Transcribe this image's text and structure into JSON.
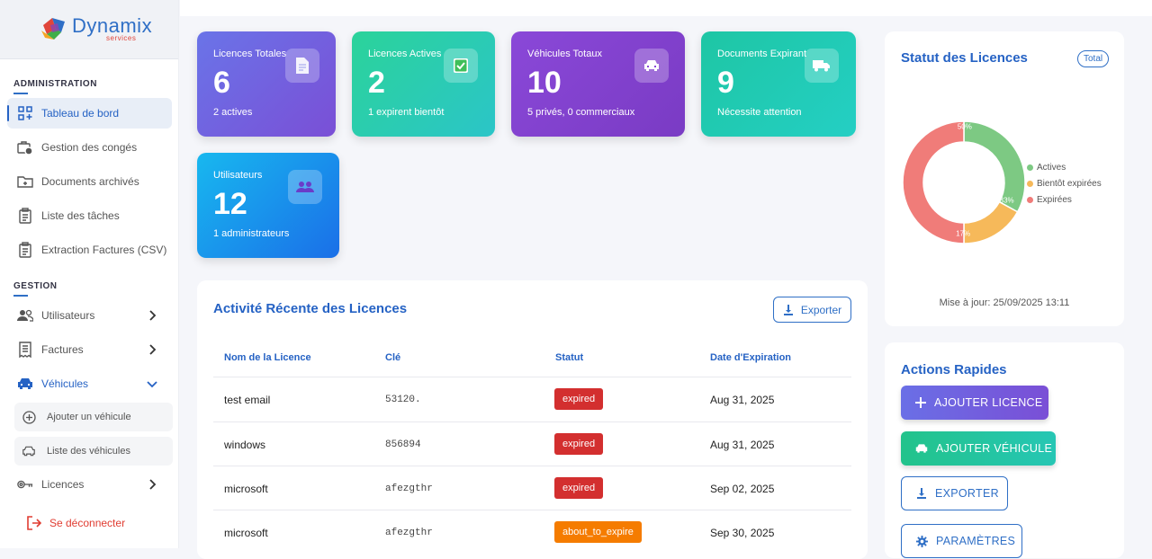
{
  "app": {
    "logo_name": "Dynamix",
    "logo_sub": "services"
  },
  "sidebar": {
    "section_admin": "ADMINISTRATION",
    "section_gestion": "GESTION",
    "items": [
      {
        "label": "Tableau de bord",
        "icon": "dashboard-icon"
      },
      {
        "label": "Gestion des congés",
        "icon": "briefcase-clock-icon"
      },
      {
        "label": "Documents archivés",
        "icon": "folder-icon"
      },
      {
        "label": "Liste des tâches",
        "icon": "clipboard-icon"
      },
      {
        "label": "Extraction Factures (CSV)",
        "icon": "clipboard-icon"
      },
      {
        "label": "Utilisateurs",
        "icon": "users-icon"
      },
      {
        "label": "Factures",
        "icon": "receipt-icon"
      },
      {
        "label": "Véhicules",
        "icon": "car-icon"
      },
      {
        "label": "Licences",
        "icon": "key-icon"
      }
    ],
    "subitems": [
      {
        "label": "Ajouter un véhicule",
        "icon": "plus-circle-icon"
      },
      {
        "label": "Liste des véhicules",
        "icon": "car-icon"
      }
    ],
    "logout": "Se déconnecter"
  },
  "stats": [
    {
      "label": "Licences Totales",
      "value": "6",
      "note": "2 actives",
      "icon": "document-icon"
    },
    {
      "label": "Licences Actives",
      "value": "2",
      "note": "1 expirent bientôt",
      "icon": "checkbox-icon"
    },
    {
      "label": "Véhicules Totaux",
      "value": "10",
      "note": "5 privés, 0 commerciaux",
      "icon": "car-icon"
    },
    {
      "label": "Documents Expirant",
      "value": "9",
      "note": "Nécessite attention",
      "icon": "truck-icon"
    },
    {
      "label": "Utilisateurs",
      "value": "12",
      "note": "1 administrateurs",
      "icon": "users-icon"
    }
  ],
  "activity": {
    "title": "Activité Récente des Licences",
    "export_label": "Exporter",
    "columns": [
      "Nom de la Licence",
      "Clé",
      "Statut",
      "Date d'Expiration"
    ],
    "rows": [
      {
        "name": "test email",
        "key": "53120.",
        "status": "expired",
        "date": "Aug 31, 2025"
      },
      {
        "name": "windows",
        "key": "856894",
        "status": "expired",
        "date": "Aug 31, 2025"
      },
      {
        "name": "microsoft",
        "key": "afezgthr",
        "status": "expired",
        "date": "Sep 02, 2025"
      },
      {
        "name": "microsoft",
        "key": "afezgthr",
        "status": "about_to_expire",
        "date": "Sep 30, 2025"
      }
    ]
  },
  "status_panel": {
    "title": "Statut des Licences",
    "badge": "Total",
    "updated": "Mise à jour: 25/09/2025 13:11"
  },
  "chart_data": {
    "type": "pie",
    "categories": [
      "Actives",
      "Bientôt expirées",
      "Expirées"
    ],
    "values": [
      33,
      17,
      50
    ],
    "labels": [
      "33%",
      "17%",
      "50%"
    ],
    "colors": [
      "#7dc983",
      "#f6b95a",
      "#f07c79"
    ],
    "legend": "right"
  },
  "quick_actions": {
    "title": "Actions Rapides",
    "buttons": [
      {
        "label": "AJOUTER LICENCE",
        "icon": "plus-icon"
      },
      {
        "label": "AJOUTER VÉHICULE",
        "icon": "car-icon"
      },
      {
        "label": "EXPORTER",
        "icon": "download-icon"
      },
      {
        "label": "PARAMÈTRES",
        "icon": "gear-icon"
      }
    ]
  },
  "colors": {
    "primary": "#2562c4",
    "expired": "#d32f2f",
    "about_to_expire": "#f57c00"
  }
}
